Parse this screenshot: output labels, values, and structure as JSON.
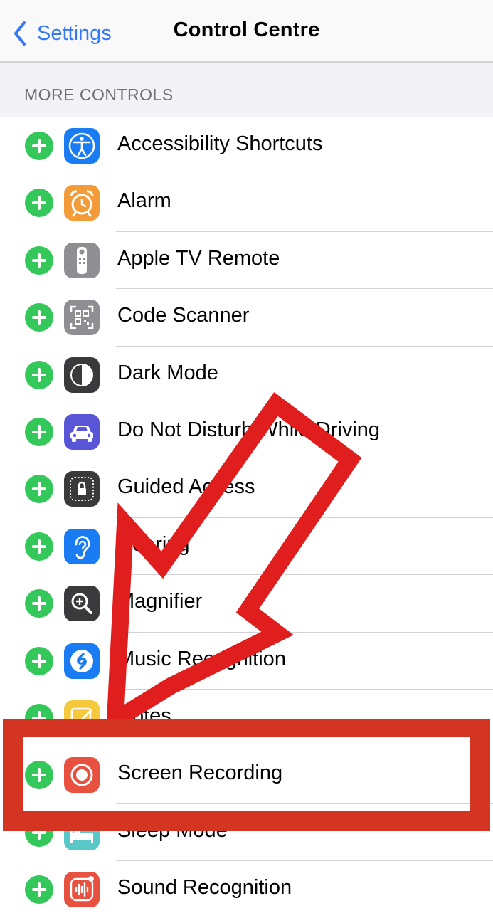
{
  "nav": {
    "back_label": "Settings",
    "title": "Control Centre"
  },
  "section_header": "MORE CONTROLS",
  "controls": [
    {
      "label": "Accessibility Shortcuts",
      "icon": "accessibility-icon",
      "color": "#1a7cf2"
    },
    {
      "label": "Alarm",
      "icon": "alarm-clock-icon",
      "color": "#f29b38"
    },
    {
      "label": "Apple TV Remote",
      "icon": "tv-remote-icon",
      "color": "#8e8e93"
    },
    {
      "label": "Code Scanner",
      "icon": "qr-code-icon",
      "color": "#8e8e93"
    },
    {
      "label": "Dark Mode",
      "icon": "dark-mode-icon",
      "color": "#3a3a3c"
    },
    {
      "label": "Do Not Disturb While Driving",
      "icon": "car-icon",
      "color": "#5856d6"
    },
    {
      "label": "Guided Access",
      "icon": "lock-icon",
      "color": "#3a3a3c"
    },
    {
      "label": "Hearing",
      "icon": "ear-icon",
      "color": "#1a7cf2"
    },
    {
      "label": "Magnifier",
      "icon": "magnifier-icon",
      "color": "#3a3a3c"
    },
    {
      "label": "Music Recognition",
      "icon": "shazam-icon",
      "color": "#1a7cf2"
    },
    {
      "label": "Notes",
      "icon": "notes-icon",
      "color": "#f5c93b"
    },
    {
      "label": "Screen Recording",
      "icon": "record-icon",
      "color": "#e8503f"
    },
    {
      "label": "Sleep Mode",
      "icon": "bed-icon",
      "color": "#5ac8c8"
    },
    {
      "label": "Sound Recognition",
      "icon": "waveform-icon",
      "color": "#e8503f"
    }
  ],
  "colors": {
    "accent": "#3478f6",
    "add_button": "#34c759",
    "annotation": "#e01e1e"
  }
}
